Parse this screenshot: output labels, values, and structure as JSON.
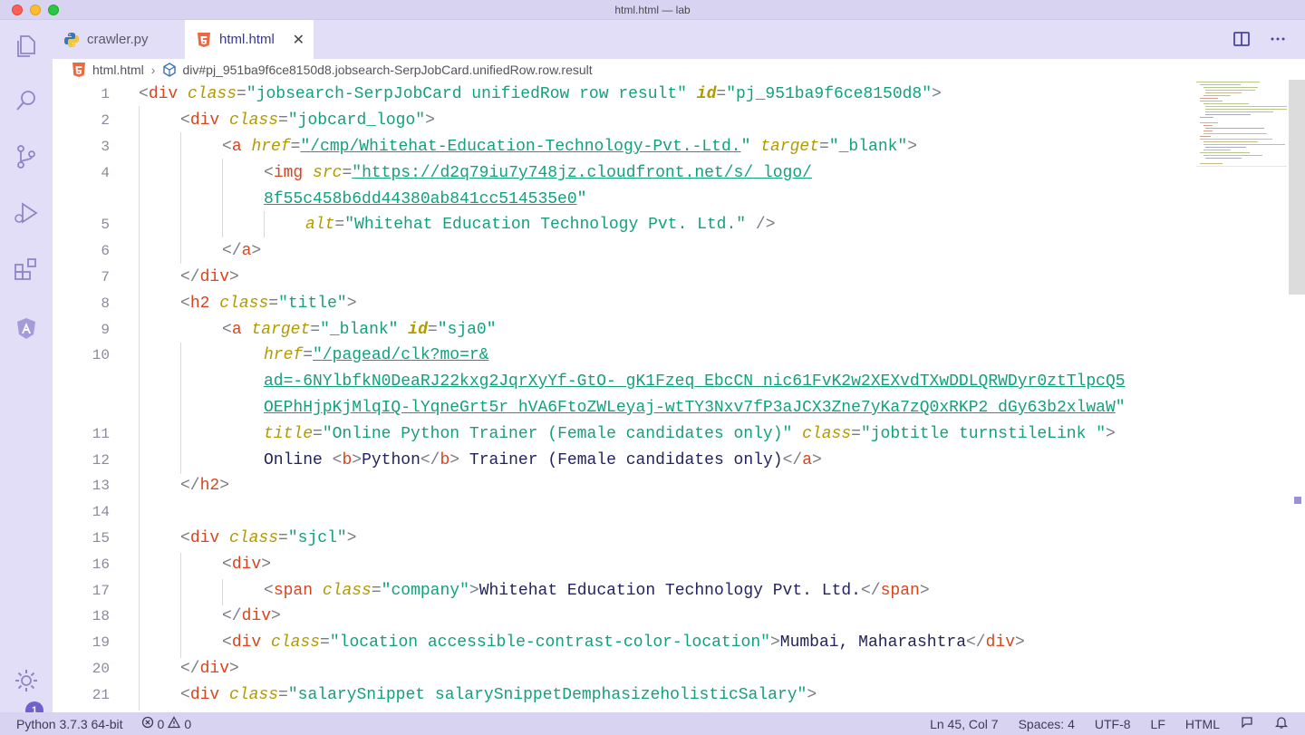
{
  "window": {
    "title": "html.html — lab"
  },
  "tabs": [
    {
      "label": "crawler.py",
      "icon": "python-icon",
      "active": false
    },
    {
      "label": "html.html",
      "icon": "html5-icon",
      "active": true,
      "close": "✕"
    }
  ],
  "breadcrumb": {
    "file": "html.html",
    "symbol": "div#pj_951ba9f6ce8150d8.jobsearch-SerpJobCard.unifiedRow.row.result"
  },
  "activity_bar": {
    "items": [
      "explorer-icon",
      "search-icon",
      "source-control-icon",
      "run-debug-icon",
      "extensions-icon",
      "angular-icon"
    ],
    "manage_badge": "1"
  },
  "editor": {
    "line_numbers": [
      "1",
      "2",
      "3",
      "4",
      "",
      "5",
      "6",
      "7",
      "8",
      "9",
      "10",
      "",
      "",
      "11",
      "12",
      "13",
      "14",
      "15",
      "16",
      "17",
      "18",
      "19",
      "20",
      "21"
    ],
    "l1": {
      "open": "<",
      "tag": "div",
      "a1": "class",
      "eq1": "=",
      "v1": "\"jobsearch-SerpJobCard unifiedRow row result\"",
      "a2": "id",
      "eq2": "=",
      "v2": "\"pj_951ba9f6ce8150d8\"",
      "close": ">"
    },
    "l2": {
      "open": "<",
      "tag": "div",
      "a1": "class",
      "eq1": "=",
      "v1": "\"jobcard_logo\"",
      "close": ">"
    },
    "l3": {
      "open": "<",
      "tag": "a",
      "a1": "href",
      "eq1": "=",
      "q1": "\"",
      "v1": "/cmp/Whitehat-Education-Technology-Pvt.-Ltd.",
      "q2": "\"",
      "a2": "target",
      "eq2": "=",
      "v2": "\"_blank\"",
      "close": ">"
    },
    "l4": {
      "open": "<",
      "tag": "img",
      "a1": "src",
      "eq1": "=",
      "q1": "\"",
      "v1": "https://d2q79iu7y748jz.cloudfront.net/s/_logo/"
    },
    "l4b": {
      "v1": "8f55c458b6dd44380ab841cc514535e0",
      "q2": "\""
    },
    "l5": {
      "a1": "alt",
      "eq1": "=",
      "v1": "\"Whitehat Education Technology Pvt. Ltd.\"",
      "close": " />"
    },
    "l6": {
      "open": "</",
      "tag": "a",
      "close": ">"
    },
    "l7": {
      "open": "</",
      "tag": "div",
      "close": ">"
    },
    "l8": {
      "open": "<",
      "tag": "h2",
      "a1": "class",
      "eq1": "=",
      "v1": "\"title\"",
      "close": ">"
    },
    "l9": {
      "open": "<",
      "tag": "a",
      "a1": "target",
      "eq1": "=",
      "v1": "\"_blank\"",
      "a2": "id",
      "eq2": "=",
      "v2": "\"sja0\""
    },
    "l10": {
      "a1": "href",
      "eq1": "=",
      "q1": "\"",
      "v1": "/pagead/clk?mo=r&"
    },
    "l10b": {
      "v1": "ad=-6NYlbfkN0DeaRJ22kxg2JqrXyYf-GtO-_gK1Fzeq_EbcCN_nic61FvK2w2XEXvdTXwDDLQRWDyr0ztTlpcQ5"
    },
    "l10c": {
      "v1": "OEPhHjpKjMlqIQ-lYqneGrt5r_hVA6FtoZWLeyaj-wtTY3Nxv7fP3aJCX3Zne7yKa7zQ0xRKP2_dGy63b2xlwaW",
      "q2": "\""
    },
    "l11": {
      "a1": "title",
      "eq1": "=",
      "v1": "\"Online Python Trainer (Female candidates only)\"",
      "a2": "class",
      "eq2": "=",
      "v2": "\"jobtitle turnstileLink \"",
      "close": ">"
    },
    "l12": {
      "t1": "Online ",
      "o1": "<",
      "tag1": "b",
      "c1": ">",
      "t2": "Python",
      "o2": "</",
      "tag2": "b",
      "c2": ">",
      "t3": " Trainer (Female candidates only)",
      "o3": "</",
      "tag3": "a",
      "c3": ">"
    },
    "l13": {
      "open": "</",
      "tag": "h2",
      "close": ">"
    },
    "l15": {
      "open": "<",
      "tag": "div",
      "a1": "class",
      "eq1": "=",
      "v1": "\"sjcl\"",
      "close": ">"
    },
    "l16": {
      "open": "<",
      "tag": "div",
      "close": ">"
    },
    "l17": {
      "open": "<",
      "tag": "span",
      "a1": "class",
      "eq1": "=",
      "v1": "\"company\"",
      "c1": ">",
      "text": "Whitehat Education Technology Pvt. Ltd.",
      "o2": "</",
      "tag2": "span",
      "close": ">"
    },
    "l18": {
      "open": "</",
      "tag": "div",
      "close": ">"
    },
    "l19": {
      "open": "<",
      "tag": "div",
      "a1": "class",
      "eq1": "=",
      "v1": "\"location accessible-contrast-color-location\"",
      "c1": ">",
      "text": "Mumbai, Maharashtra",
      "o2": "</",
      "tag2": "div",
      "close": ">"
    },
    "l20": {
      "open": "</",
      "tag": "div",
      "close": ">"
    },
    "l21": {
      "open": "<",
      "tag": "div",
      "a1": "class",
      "eq1": "=",
      "v1": "\"salarySnippet salarySnippetDemphasizeholisticSalary\"",
      "close": ">"
    }
  },
  "status": {
    "interpreter": "Python 3.7.3 64-bit",
    "errors": "0",
    "warnings": "0",
    "position": "Ln 45, Col 7",
    "spaces": "Spaces: 4",
    "encoding": "UTF-8",
    "eol": "LF",
    "language": "HTML"
  }
}
